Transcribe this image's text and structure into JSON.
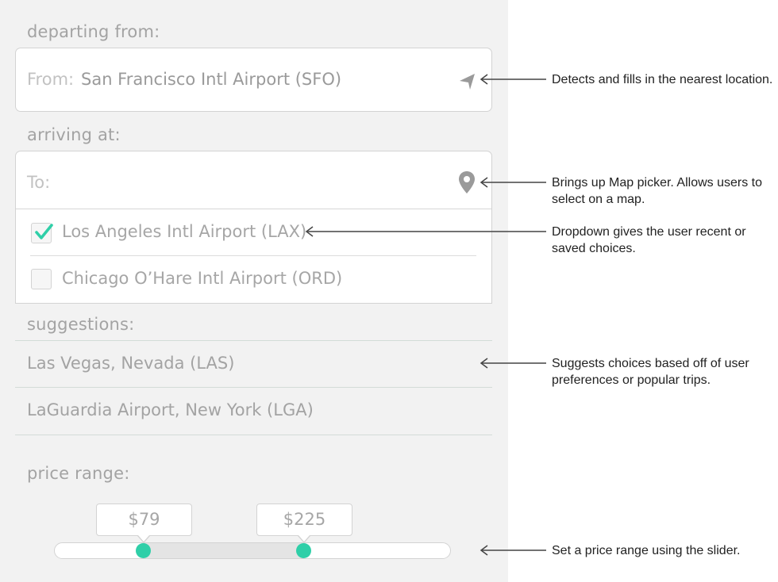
{
  "departing": {
    "section_label": "departing from:",
    "field_label": "From:",
    "field_value": "San Francisco Intl Airport (SFO)",
    "icon": "location-arrow-icon"
  },
  "arriving": {
    "section_label": "arriving at:",
    "field_label": "To:",
    "field_value": "",
    "icon": "map-pin-icon",
    "dropdown": [
      {
        "label": "Los Angeles Intl Airport (LAX)",
        "checked": true
      },
      {
        "label": "Chicago O’Hare Intl Airport (ORD)",
        "checked": false
      }
    ]
  },
  "suggestions": {
    "section_label": "suggestions:",
    "items": [
      "Las Vegas, Nevada (LAS)",
      "LaGuardia Airport, New York (LGA)"
    ]
  },
  "price_range": {
    "section_label": "price range:",
    "min_label": "$79",
    "max_label": "$225",
    "min_position": 0.226,
    "max_position": 0.63
  },
  "annotations": [
    "Detects and fills in the nearest location.",
    "Brings up Map picker. Allows users to select on a map.",
    "Dropdown gives the user recent or saved choices.",
    "Suggests choices based off of user preferences or popular trips.",
    "Set a price range using the slider."
  ],
  "colors": {
    "panel_bg": "#f2f2f2",
    "accent": "#2fcfa8",
    "muted_text": "#a3a3a3",
    "annotation_text": "#222222"
  }
}
